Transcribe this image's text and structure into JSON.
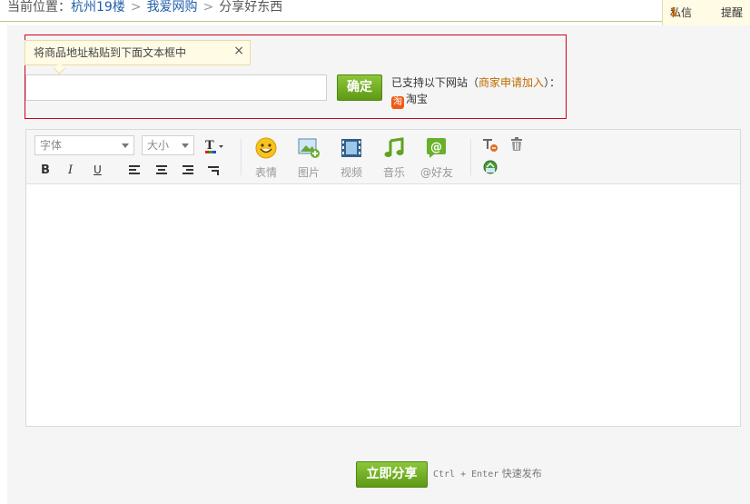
{
  "breadcrumb": {
    "prefix": "当前位置：",
    "items": [
      "杭州19楼",
      "我爱网购",
      "分享好东西"
    ]
  },
  "topbar": {
    "messages_label": "私信",
    "messages_count": "1",
    "remind_label": "提醒"
  },
  "link_panel": {
    "tooltip": "将商品地址粘贴到下面文本框中",
    "close": "×",
    "url_value": "",
    "confirm_label": "确定",
    "supported_prefix": "已支持以下网站（",
    "apply_link": "商家申请加入",
    "supported_suffix": "）：",
    "sites": [
      {
        "icon": "淘",
        "name": "淘宝"
      }
    ]
  },
  "toolbar": {
    "font_select": "字体",
    "size_select": "大小",
    "format_buttons": [
      "B",
      "I",
      "U"
    ],
    "media": [
      {
        "label": "表情",
        "icon": "emoticon-icon"
      },
      {
        "label": "图片",
        "icon": "image-icon"
      },
      {
        "label": "视频",
        "icon": "video-icon"
      },
      {
        "label": "音乐",
        "icon": "music-icon"
      },
      {
        "label": "@好友",
        "icon": "at-friend-icon"
      }
    ]
  },
  "footer": {
    "share_label": "立即分享",
    "shortcut": "Ctrl + Enter",
    "shortcut_suffix": "快速发布"
  },
  "colors": {
    "accent_green": "#6aa51d",
    "link_blue": "#1f5ea8",
    "error_red": "#d0021b",
    "apply_orange": "#c06a00"
  }
}
